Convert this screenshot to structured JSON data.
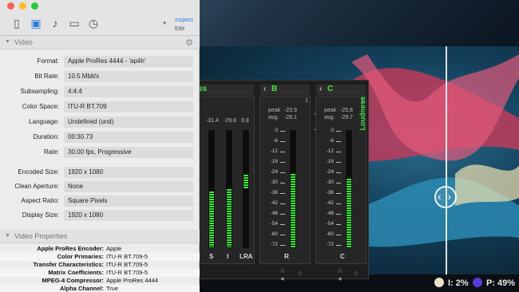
{
  "inspector": {
    "toolbar": {
      "inspect_label": "Inspect",
      "edit_label": "Edit"
    },
    "video_section": {
      "title": "Video",
      "rows": [
        {
          "label": "Format:",
          "value": "Apple ProRes 4444 - 'ap4h'"
        },
        {
          "label": "Bit Rate:",
          "value": "10.5 Mbit/s"
        },
        {
          "label": "Subsampling:",
          "value": "4:4:4"
        },
        {
          "label": "Color Space:",
          "value": "ITU-R BT.709"
        },
        {
          "label": "Language:",
          "value": "Undefined (und)"
        },
        {
          "label": "Duration:",
          "value": "00:30.73"
        },
        {
          "label": "Rate:",
          "value": "30.00 fps, Progressive"
        },
        {
          "label": "Encoded Size:",
          "value": "1920 x 1080"
        },
        {
          "label": "Clean Aperture:",
          "value": "None"
        },
        {
          "label": "Aspect Ratio:",
          "value": "Square Pixels"
        },
        {
          "label": "Display Size:",
          "value": "1920 x 1080"
        }
      ]
    },
    "video_properties": {
      "title": "Video Properties",
      "rows": [
        {
          "label": "Apple ProRes Encoder:",
          "value": "Apple"
        },
        {
          "label": "Color Primaries:",
          "value": "ITU-R BT.709-5"
        },
        {
          "label": "Transfer Characteristics:",
          "value": "ITU-R BT.709-5"
        },
        {
          "label": "Matrix Coefficients:",
          "value": "ITU-R BT.709-5"
        },
        {
          "label": "MPEG-4 Compressor:",
          "value": "Apple ProRes 4444"
        },
        {
          "label": "Alpha Channel:",
          "value": "True"
        }
      ]
    }
  },
  "meter": {
    "group1": {
      "title": "Loudness",
      "values": [
        "-31.4",
        "-29.8",
        "9.8"
      ],
      "labels": [
        "S",
        "I",
        "LRA"
      ],
      "fills": [
        0.47,
        0.49,
        0.12
      ]
    },
    "channel_b": {
      "name": "B",
      "number": "1",
      "peak_label": "peak",
      "peak": "-23.9",
      "avg_label": "avg.",
      "avg": "-28.1",
      "footer": "R",
      "fill": 0.62
    },
    "channel_c": {
      "name": "C",
      "number": "1",
      "peak_label": "peak",
      "peak": "-25.8",
      "avg_label": "avg.",
      "avg": "-29.7",
      "footer": "C",
      "fill": 0.58
    },
    "loudness_label": "Loudness",
    "scale": [
      "0",
      "-6",
      "-12",
      "-18",
      "-24",
      "-30",
      "-36",
      "-42",
      "-48",
      "-54",
      "-60",
      "-72"
    ]
  },
  "status": {
    "i_text": "I: 2%",
    "p_text": "P: 49%",
    "i_color": "#e8e2c8",
    "p_color": "#5a3bd6"
  }
}
